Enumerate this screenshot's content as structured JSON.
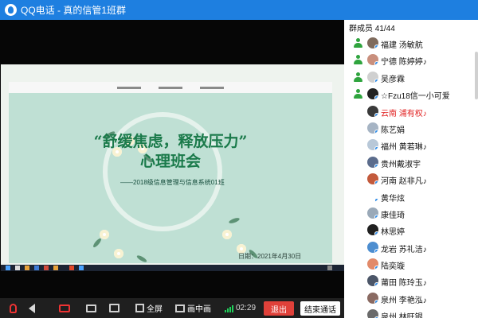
{
  "window": {
    "title": "QQ电话 - 真的信管1班群"
  },
  "slide": {
    "title": "“舒缓焦虑，释放压力”",
    "subtitle": "心理班会",
    "class_line": "——2018级信息管理与信息系统01班",
    "date": "日期：2021年4月30日"
  },
  "controls": {
    "fullscreen_label": "全屏",
    "pip_label": "画中画",
    "timer": "02:29",
    "exit_label": "退出",
    "end_call_label": "结束通话"
  },
  "members": {
    "header": "群成员 41/44",
    "items": [
      {
        "name": "福建 汤敏航",
        "admin": true,
        "avatar_color": "#7f6b5d"
      },
      {
        "name": "宁德 陈婷婷♪",
        "admin": true,
        "avatar_color": "#c98f7d"
      },
      {
        "name": "吴彦霖",
        "admin": true,
        "avatar_color": "#d0d0d0"
      },
      {
        "name": "☆Fzu18信一小可爱",
        "admin": true,
        "avatar_color": "#222222"
      },
      {
        "name": "云南 浦有权♪",
        "admin": false,
        "avatar_color": "#3a3a3a",
        "highlight": true
      },
      {
        "name": "陈艺娟",
        "admin": false,
        "avatar_color": "#a6b4c4"
      },
      {
        "name": "福州 黄若琳♪",
        "admin": false,
        "avatar_color": "#b8c8d8"
      },
      {
        "name": "贵州戴淑宇",
        "admin": false,
        "avatar_color": "#5b6c8c"
      },
      {
        "name": "河南 赵非凡♪",
        "admin": false,
        "avatar_color": "#c35a3c"
      },
      {
        "name": "黄华炫",
        "admin": false,
        "avatar_color": "#ffffff"
      },
      {
        "name": "康佳琦",
        "admin": false,
        "avatar_color": "#9aa9b8"
      },
      {
        "name": "林思婷",
        "admin": false,
        "avatar_color": "#202020"
      },
      {
        "name": "龙岩 苏礼洁♪",
        "admin": false,
        "avatar_color": "#4d8ed0"
      },
      {
        "name": "陆奕璇",
        "admin": false,
        "avatar_color": "#e28a6a"
      },
      {
        "name": "莆田 陈玲玉♪",
        "admin": false,
        "avatar_color": "#4c5668"
      },
      {
        "name": "泉州 李艳泓♪",
        "admin": false,
        "avatar_color": "#8a6a62"
      },
      {
        "name": "泉州 林旺银",
        "admin": false,
        "avatar_color": "#6a6a6a"
      }
    ]
  }
}
